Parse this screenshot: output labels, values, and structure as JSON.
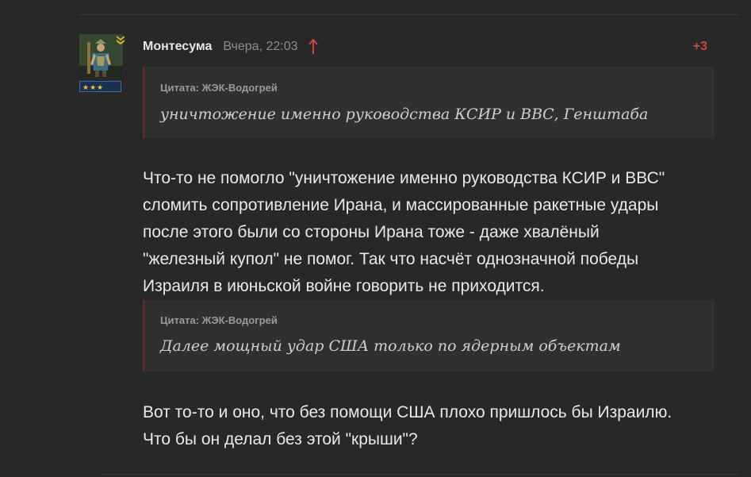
{
  "comment": {
    "author": "Монтесума",
    "timestamp": "Вчера, 22:03",
    "rating": "+3",
    "rank_stars": "★★★"
  },
  "quotes": [
    {
      "source": "Цитата: ЖЭК-Водогрей",
      "text": "уничтожение именно руководства КСИР и ВВС, Генштаба"
    },
    {
      "source": "Цитата: ЖЭК-Водогрей",
      "text": "Далее мощный удар США только по ядерным объектам"
    }
  ],
  "paragraphs": [
    {
      "lines": [
        "Что-то не помогло \"уничтожение именно руководства КСИР и ВВС\"",
        "сломить сопротивление Ирана, и массированные ракетные удары",
        "после этого были со стороны Ирана тоже - даже хвалёный",
        "\"железный купол\" не помог. Так что насчёт однозначной победы",
        "Израиля в июньской войне говорить не приходится."
      ]
    },
    {
      "lines": [
        "Вот то-то и оно, что без помощи США плохо пришлось бы Израилю.",
        "Что бы он делал без этой \"крыши\"?"
      ]
    }
  ],
  "colors": {
    "background": "#282828",
    "quote_background": "#303030",
    "quote_border": "#6e2a28",
    "rating": "#c8473f",
    "rank_chevron": "#d6b428"
  },
  "icons": {
    "avatar": "avatar-icon",
    "rank": "rank-chevron-icon",
    "vote": "arrow-up-icon"
  }
}
